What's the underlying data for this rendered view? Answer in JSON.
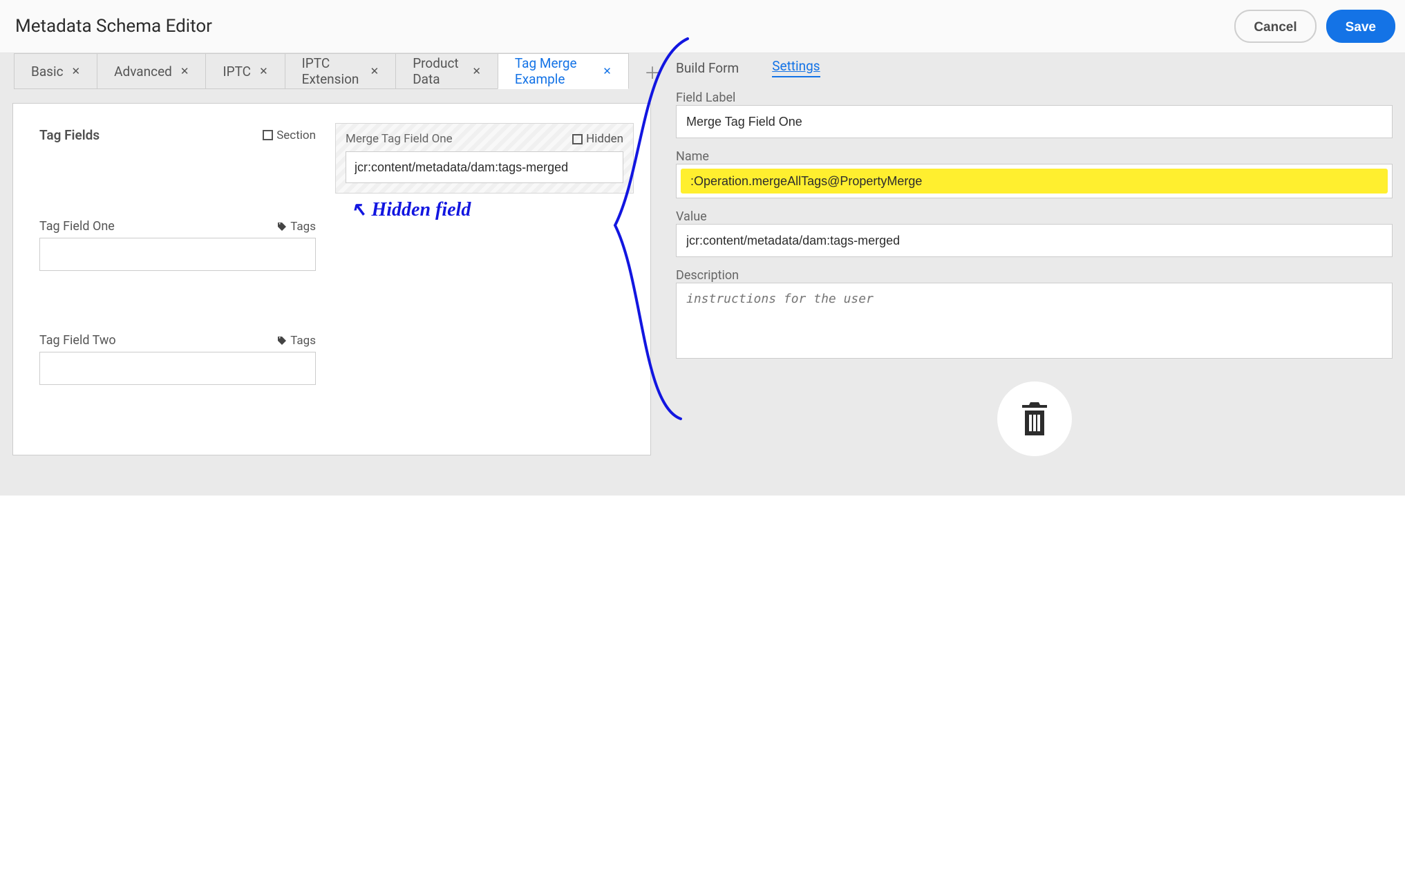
{
  "header": {
    "title": "Metadata Schema Editor",
    "cancel": "Cancel",
    "save": "Save"
  },
  "tabs": [
    {
      "label": "Basic"
    },
    {
      "label": "Advanced"
    },
    {
      "label": "IPTC"
    },
    {
      "label": "IPTC Extension"
    },
    {
      "label": "Product Data"
    },
    {
      "label": "Tag Merge Example",
      "active": true
    }
  ],
  "sideTabs": {
    "build": "Build Form",
    "settings": "Settings"
  },
  "canvas": {
    "sectionTitle": "Tag Fields",
    "sectionCheck": "Section",
    "tagField1": {
      "label": "Tag Field One",
      "pill": "Tags"
    },
    "tagField2": {
      "label": "Tag Field Two",
      "pill": "Tags"
    },
    "hiddenTile": {
      "title": "Merge Tag Field One",
      "hiddenCheck": "Hidden",
      "value": "jcr:content/metadata/dam:tags-merged"
    },
    "handwritten": "↖ Hidden field"
  },
  "settings": {
    "fieldLabel": {
      "label": "Field Label",
      "value": "Merge Tag Field One"
    },
    "name": {
      "label": "Name",
      "value": ":Operation.mergeAllTags@PropertyMerge"
    },
    "value": {
      "label": "Value",
      "value": "jcr:content/metadata/dam:tags-merged"
    },
    "description": {
      "label": "Description",
      "placeholder": "instructions for the user"
    }
  }
}
